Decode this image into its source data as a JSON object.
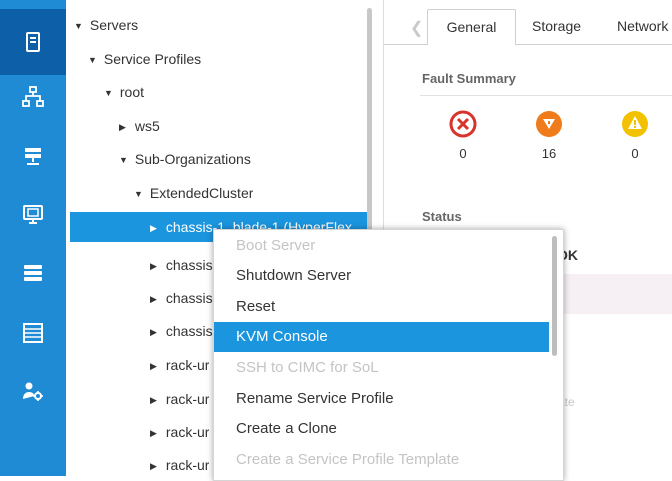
{
  "tree": {
    "rows": [
      {
        "label": "Servers"
      },
      {
        "label": "Service Profiles"
      },
      {
        "label": "root"
      },
      {
        "label": "ws5"
      },
      {
        "label": "Sub-Organizations"
      },
      {
        "label": "ExtendedCluster"
      },
      {
        "label": "chassis-1_blade-1 (HyperFlex"
      },
      {
        "label": "chassis"
      },
      {
        "label": "chassis"
      },
      {
        "label": "chassis"
      },
      {
        "label": "rack-ur"
      },
      {
        "label": "rack-ur"
      },
      {
        "label": "rack-ur"
      },
      {
        "label": "rack-ur"
      }
    ]
  },
  "tabs": [
    {
      "label": "General"
    },
    {
      "label": "Storage"
    },
    {
      "label": "Network"
    }
  ],
  "fault_summary": {
    "title": "Fault Summary",
    "counts": [
      {
        "value": "0",
        "severity": "critical",
        "color": "#d9342b"
      },
      {
        "value": "16",
        "severity": "major",
        "color": "#f07b1a"
      },
      {
        "value": "0",
        "severity": "minor",
        "color": "#f2c200"
      }
    ]
  },
  "status": {
    "title": "Status",
    "overall": "OK",
    "dim_text": "S"
  },
  "right_dim_text": "ate",
  "context_menu": {
    "items": [
      {
        "label": "Boot Server",
        "enabled": false
      },
      {
        "label": "Shutdown Server",
        "enabled": true
      },
      {
        "label": "Reset",
        "enabled": true
      },
      {
        "label": "KVM Console",
        "enabled": true,
        "highlighted": true
      },
      {
        "label": "SSH to CIMC for SoL",
        "enabled": false
      },
      {
        "label": "Rename Service Profile",
        "enabled": true
      },
      {
        "label": "Create a Clone",
        "enabled": true
      },
      {
        "label": "Create a Service Profile Template",
        "enabled": false
      }
    ]
  },
  "colors": {
    "rail": "#1f8bd4",
    "rail_active": "#0d5fa8",
    "selection": "#1b95de"
  }
}
